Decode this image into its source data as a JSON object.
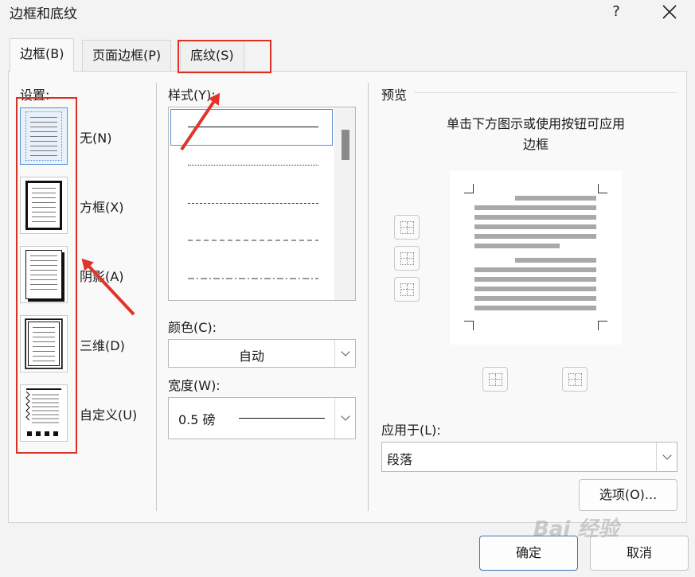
{
  "dialog": {
    "title": "边框和底纹",
    "help": "?"
  },
  "tabs": [
    {
      "label": "边框(B)",
      "active": true
    },
    {
      "label": "页面边框(P)",
      "active": false
    },
    {
      "label": "底纹(S)",
      "active": false
    }
  ],
  "settings": {
    "heading": "设置:",
    "items": [
      {
        "label": "无(N)",
        "selected": true
      },
      {
        "label": "方框(X)",
        "selected": false
      },
      {
        "label": "阴影(A)",
        "selected": false
      },
      {
        "label": "三维(D)",
        "selected": false
      },
      {
        "label": "自定义(U)",
        "selected": false
      }
    ]
  },
  "style": {
    "heading": "样式(Y):",
    "items": [
      "solid",
      "dotted",
      "dashed",
      "long-dashed",
      "dash-dot"
    ]
  },
  "color": {
    "heading": "颜色(C):",
    "value": "自动"
  },
  "width": {
    "heading": "宽度(W):",
    "value": "0.5 磅"
  },
  "preview": {
    "heading": "预览",
    "hint": "单击下方图示或使用按钮可应用\n边框"
  },
  "apply_to": {
    "heading": "应用于(L):",
    "value": "段落"
  },
  "buttons": {
    "options": "选项(O)...",
    "ok": "确定",
    "cancel": "取消"
  },
  "watermark": "Bai 经验",
  "colors": {
    "highlight": "#d93025",
    "selection": "#5b8fd0"
  }
}
